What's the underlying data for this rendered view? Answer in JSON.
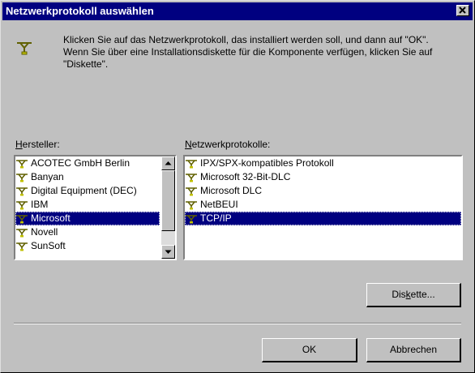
{
  "window": {
    "title": "Netzwerkprotokoll auswählen"
  },
  "intro": {
    "icon": "network-protocol-icon",
    "text": "Klicken Sie auf das Netzwerkprotokoll, das installiert werden soll, und dann auf \"OK\". Wenn Sie über eine Installationsdiskette für die Komponente verfügen, klicken Sie auf \"Diskette\"."
  },
  "manufacturers": {
    "label_mnemonic": "H",
    "label_rest": "ersteller:",
    "items": [
      "ACOTEC GmbH Berlin",
      "Banyan",
      "Digital Equipment (DEC)",
      "IBM",
      "Microsoft",
      "Novell",
      "SunSoft"
    ],
    "selected": "Microsoft"
  },
  "protocols": {
    "label_mnemonic": "N",
    "label_rest": "etzwerkprotokolle:",
    "items": [
      "IPX/SPX-kompatibles Protokoll",
      "Microsoft 32-Bit-DLC",
      "Microsoft DLC",
      "NetBEUI",
      "TCP/IP"
    ],
    "selected": "TCP/IP"
  },
  "buttons": {
    "disk_pre": "Dis",
    "disk_mnemonic": "k",
    "disk_post": "ette...",
    "ok": "OK",
    "cancel": "Abbrechen"
  },
  "colors": {
    "face": "#c0c0c0",
    "titlebar": "#000080",
    "selection": "#000080"
  }
}
